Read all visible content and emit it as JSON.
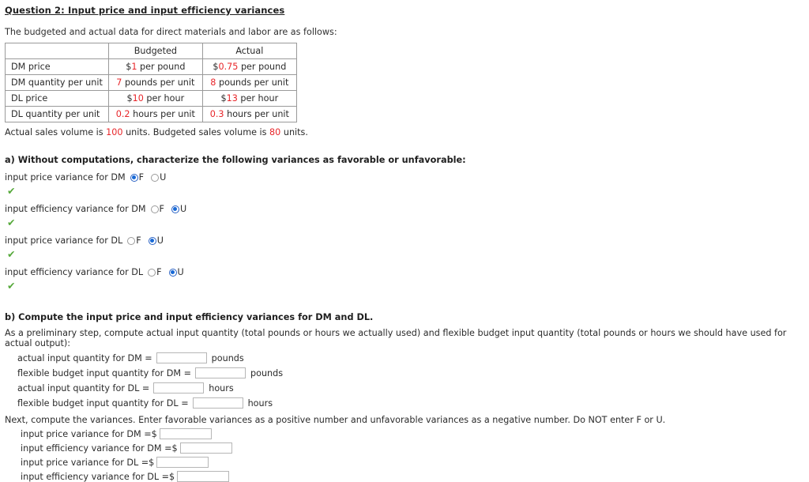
{
  "question": {
    "title": "Question 2: Input price and input efficiency variances",
    "intro": "The budgeted and actual data for direct materials and labor are as follows:"
  },
  "table": {
    "headers": [
      "",
      "Budgeted",
      "Actual"
    ],
    "rows": [
      {
        "label": "DM price",
        "budgeted": {
          "prefix": "$",
          "number": "1",
          "suffix": " per pound"
        },
        "actual": {
          "prefix": "$",
          "number": "0.75",
          "suffix": " per pound"
        }
      },
      {
        "label": "DM quantity per unit",
        "budgeted": {
          "prefix": "",
          "number": "7",
          "suffix": " pounds per unit"
        },
        "actual": {
          "prefix": "",
          "number": "8",
          "suffix": " pounds per unit"
        }
      },
      {
        "label": "DL price",
        "budgeted": {
          "prefix": "$",
          "number": "10",
          "suffix": " per hour"
        },
        "actual": {
          "prefix": "$",
          "number": "13",
          "suffix": " per hour"
        }
      },
      {
        "label": "DL quantity per unit",
        "budgeted": {
          "prefix": "",
          "number": "0.2",
          "suffix": " hours per unit"
        },
        "actual": {
          "prefix": "",
          "number": "0.3",
          "suffix": " hours per unit"
        }
      }
    ]
  },
  "volume": {
    "part1": "Actual sales volume is ",
    "actual_value": "100",
    "part2": " units. Budgeted sales volume is ",
    "budgeted_value": "80",
    "part3": " units."
  },
  "part_a": {
    "heading": "a) Without computations, characterize the following variances as favorable or unfavorable:",
    "option_f": "F",
    "option_u": "U",
    "check_mark": "✔",
    "items": [
      {
        "label": "input price variance for DM",
        "selected": "F"
      },
      {
        "label": "input efficiency variance for DM",
        "selected": "U"
      },
      {
        "label": "input price variance for DL",
        "selected": "U"
      },
      {
        "label": "input efficiency variance for DL",
        "selected": "U"
      }
    ]
  },
  "part_b": {
    "heading": "b) Compute the input price and input efficiency variances for DM and DL.",
    "prelim": "As a preliminary step, compute actual input quantity (total pounds or hours we actually used) and flexible budget input quantity (total pounds or hours we should have used for actual output):",
    "quantity_fields": [
      {
        "label": "actual input quantity for DM =",
        "value": "",
        "unit": "pounds"
      },
      {
        "label": "flexible budget input quantity for DM =",
        "value": "",
        "unit": "pounds"
      },
      {
        "label": "actual input quantity for DL =",
        "value": "",
        "unit": "hours"
      },
      {
        "label": "flexible budget input quantity for DL =",
        "value": "",
        "unit": "hours"
      }
    ],
    "next_line": "Next, compute the variances. Enter favorable variances as a positive number and unfavorable variances as a negative number. Do NOT enter F or U.",
    "currency_symbol": "$",
    "variance_fields": [
      {
        "label": "input price variance for DM =",
        "value": ""
      },
      {
        "label": "input efficiency variance for DM =",
        "value": ""
      },
      {
        "label": "input price variance for DL =",
        "value": ""
      },
      {
        "label": "input efficiency variance for DL =",
        "value": ""
      }
    ]
  }
}
